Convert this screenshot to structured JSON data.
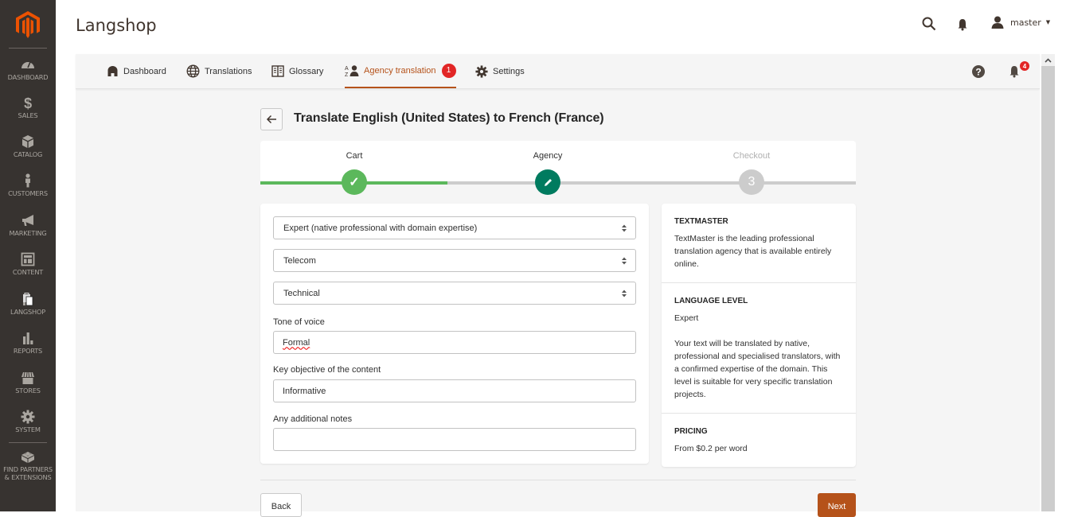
{
  "app": {
    "title": "Langshop",
    "brand_color": "#eb5202",
    "accent_color": "#b5521a"
  },
  "sidebar": {
    "items": [
      {
        "label": "DASHBOARD",
        "icon": "dashboard-gauge-icon"
      },
      {
        "label": "SALES",
        "icon": "dollar-icon"
      },
      {
        "label": "CATALOG",
        "icon": "box-icon"
      },
      {
        "label": "CUSTOMERS",
        "icon": "person-icon"
      },
      {
        "label": "MARKETING",
        "icon": "megaphone-icon"
      },
      {
        "label": "CONTENT",
        "icon": "layout-icon"
      },
      {
        "label": "LANGSHOP",
        "icon": "shopping-bags-icon"
      },
      {
        "label": "REPORTS",
        "icon": "bar-chart-icon"
      },
      {
        "label": "STORES",
        "icon": "storefront-icon"
      },
      {
        "label": "SYSTEM",
        "icon": "gear-icon"
      },
      {
        "label": "FIND PARTNERS",
        "label2": "& EXTENSIONS",
        "icon": "lego-brick-icon"
      }
    ]
  },
  "header": {
    "user": "master"
  },
  "topnav": {
    "tabs": [
      {
        "label": "Dashboard",
        "icon": "home-icon"
      },
      {
        "label": "Translations",
        "icon": "globe-icon"
      },
      {
        "label": "Glossary",
        "icon": "book-icon"
      },
      {
        "label": "Agency translation",
        "icon": "translate-people-icon",
        "badge": "1",
        "active": true
      },
      {
        "label": "Settings",
        "icon": "gear-icon"
      }
    ],
    "notifications_count": "4"
  },
  "page": {
    "heading": "Translate English (United States) to French (France)",
    "steps": [
      {
        "label": "Cart",
        "state": "done",
        "glyph": "✓"
      },
      {
        "label": "Agency",
        "state": "current",
        "glyph": "✎"
      },
      {
        "label": "Checkout",
        "state": "pending",
        "glyph": "3"
      }
    ],
    "form": {
      "level_select": "Expert (native professional with domain expertise)",
      "domain_select": "Telecom",
      "type_select": "Technical",
      "tone_label": "Tone of voice",
      "tone_value": "Formal",
      "objective_label": "Key objective of the content",
      "objective_value": "Informative",
      "notes_label": "Any additional notes",
      "notes_value": ""
    },
    "info": {
      "agency_title": "TEXTMASTER",
      "agency_text": "TextMaster is the leading professional translation agency that is available entirely online.",
      "level_title": "LANGUAGE LEVEL",
      "level_value": "Expert",
      "level_text": "Your text will be translated by native, professional and specialised translators, with a confirmed expertise of the domain. This level is suitable for very specific translation projects.",
      "pricing_title": "PRICING",
      "pricing_text": "From $0.2 per word"
    },
    "buttons": {
      "back": "Back",
      "next": "Next"
    }
  }
}
